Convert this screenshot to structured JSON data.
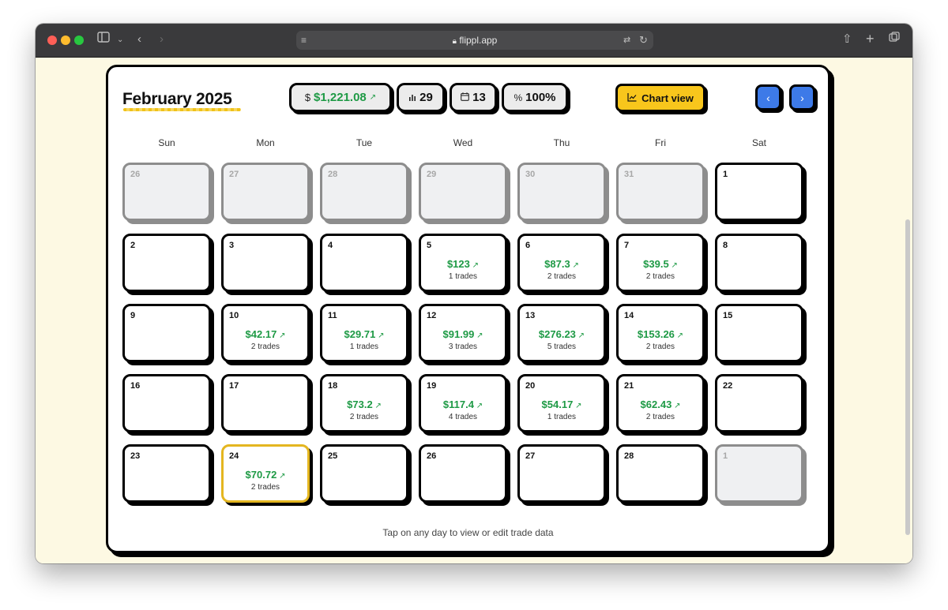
{
  "browser": {
    "url": "flippl.app"
  },
  "header": {
    "month_title": "February 2025",
    "profit_symbol": "$",
    "profit": "$1,221.08",
    "trade_count": "29",
    "active_days": "13",
    "win_rate": "100%",
    "chart_button_label": "Chart view",
    "prev_symbol": "‹",
    "next_symbol": "›"
  },
  "weekdays": [
    "Sun",
    "Mon",
    "Tue",
    "Wed",
    "Thu",
    "Fri",
    "Sat"
  ],
  "days": [
    {
      "num": "26",
      "muted": true
    },
    {
      "num": "27",
      "muted": true
    },
    {
      "num": "28",
      "muted": true
    },
    {
      "num": "29",
      "muted": true
    },
    {
      "num": "30",
      "muted": true
    },
    {
      "num": "31",
      "muted": true
    },
    {
      "num": "1"
    },
    {
      "num": "2"
    },
    {
      "num": "3"
    },
    {
      "num": "4"
    },
    {
      "num": "5",
      "pnl": "$123",
      "trades": "1 trades"
    },
    {
      "num": "6",
      "pnl": "$87.3",
      "trades": "2 trades"
    },
    {
      "num": "7",
      "pnl": "$39.5",
      "trades": "2 trades"
    },
    {
      "num": "8"
    },
    {
      "num": "9"
    },
    {
      "num": "10",
      "pnl": "$42.17",
      "trades": "2 trades"
    },
    {
      "num": "11",
      "pnl": "$29.71",
      "trades": "1 trades"
    },
    {
      "num": "12",
      "pnl": "$91.99",
      "trades": "3 trades"
    },
    {
      "num": "13",
      "pnl": "$276.23",
      "trades": "5 trades"
    },
    {
      "num": "14",
      "pnl": "$153.26",
      "trades": "2 trades"
    },
    {
      "num": "15"
    },
    {
      "num": "16"
    },
    {
      "num": "17"
    },
    {
      "num": "18",
      "pnl": "$73.2",
      "trades": "2 trades"
    },
    {
      "num": "19",
      "pnl": "$117.4",
      "trades": "4 trades"
    },
    {
      "num": "20",
      "pnl": "$54.17",
      "trades": "1 trades"
    },
    {
      "num": "21",
      "pnl": "$62.43",
      "trades": "2 trades"
    },
    {
      "num": "22"
    },
    {
      "num": "23"
    },
    {
      "num": "24",
      "pnl": "$70.72",
      "trades": "2 trades",
      "today": true
    },
    {
      "num": "25"
    },
    {
      "num": "26"
    },
    {
      "num": "27"
    },
    {
      "num": "28"
    },
    {
      "num": "1",
      "muted": true
    }
  ],
  "footer_hint": "Tap on any day to view or edit trade data",
  "colors": {
    "accent_yellow": "#f8c61c",
    "nav_blue": "#3d7ae8",
    "profit_green": "#1e9a45",
    "page_background": "#fdf9e3"
  },
  "icons": {
    "trend": "trend-up-icon",
    "trades": "bar-chart-icon",
    "days": "calendar-icon",
    "win_rate": "percent-icon"
  }
}
